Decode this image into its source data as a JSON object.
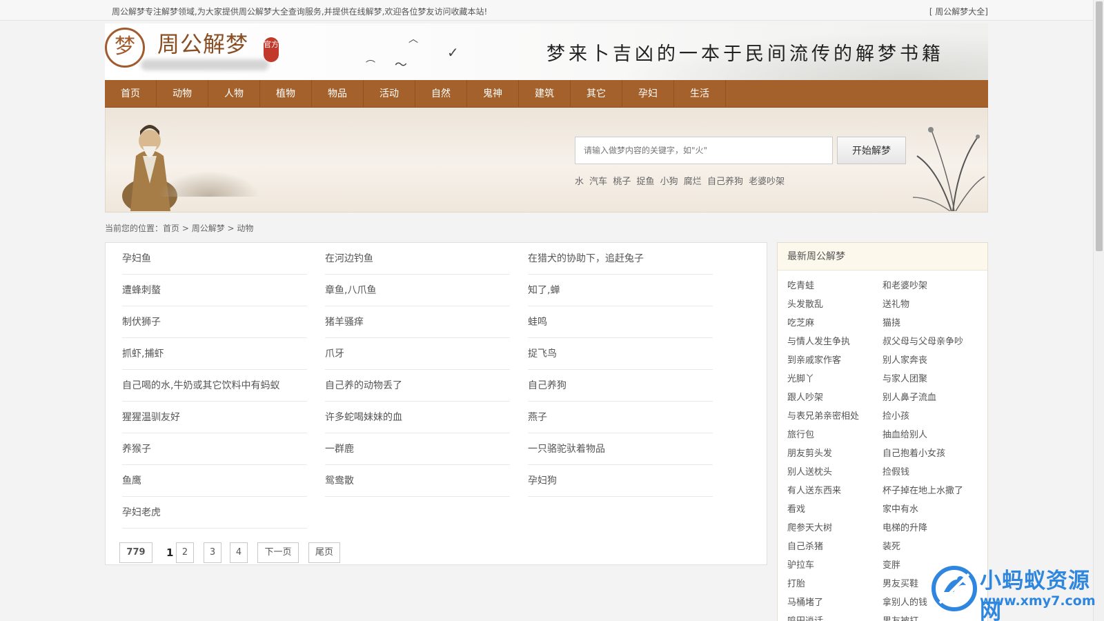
{
  "topbar": {
    "notice": "周公解梦专注解梦领域,为大家提供周公解梦大全查询服务,并提供在线解梦,欢迎各位梦友访问收藏本站!",
    "favorite": "[ 周公解梦大全]"
  },
  "header": {
    "logo_seal": "梦",
    "logo_text": "周公解梦",
    "logo_stamp": "官方",
    "slogan": "梦来卜吉凶的一本于民间流传的解梦书籍"
  },
  "nav": [
    "首页",
    "动物",
    "人物",
    "植物",
    "物品",
    "活动",
    "自然",
    "鬼神",
    "建筑",
    "其它",
    "孕妇",
    "生活"
  ],
  "search": {
    "placeholder": "请输入做梦内容的关键字，如\"火\"",
    "button": "开始解梦",
    "hot_words": [
      "水",
      "汽车",
      "桃子",
      "捉鱼",
      "小狗",
      "腐烂",
      "自己养狗",
      "老婆吵架"
    ]
  },
  "breadcrumb": {
    "prefix": "当前您的位置：",
    "items": [
      "首页",
      "周公解梦",
      "动物"
    ],
    "sep": " > "
  },
  "dream_list": [
    [
      "孕妇鱼",
      "在河边钓鱼",
      "在猎犬的协助下，追赶兔子"
    ],
    [
      "遭蜂刺螯",
      "章鱼,八爪鱼",
      "知了,蝉"
    ],
    [
      "制伏狮子",
      "猪羊骚痒",
      "蛙鸣"
    ],
    [
      "抓虾,捕虾",
      "爪牙",
      "捉飞鸟"
    ],
    [
      "自己喝的水,牛奶或其它饮料中有蚂蚁",
      "自己养的动物丢了",
      "自己养狗"
    ],
    [
      "猩猩温驯友好",
      "许多蛇喝妹妹的血",
      "燕子"
    ],
    [
      "养猴子",
      "一群鹿",
      "一只骆驼驮着物品"
    ],
    [
      "鱼鹰",
      "鸳鸯散",
      "孕妇狗"
    ],
    [
      "孕妇老虎"
    ]
  ],
  "pagination": {
    "total": "779",
    "current": "1",
    "pages": [
      "2",
      "3",
      "4"
    ],
    "next": "下一页",
    "last": "尾页"
  },
  "sidebar": {
    "title": "最新周公解梦",
    "links": [
      [
        "吃青蛙",
        "和老婆吵架"
      ],
      [
        "头发散乱",
        "送礼物"
      ],
      [
        "吃芝麻",
        "猫挠"
      ],
      [
        "与情人发生争执",
        "叔父母与父母亲争吵"
      ],
      [
        "到亲戚家作客",
        "别人家奔丧"
      ],
      [
        "光脚丫",
        "与家人团聚"
      ],
      [
        "跟人吵架",
        "别人鼻子流血"
      ],
      [
        "与表兄弟亲密相处",
        "捡小孩"
      ],
      [
        "旅行包",
        "抽血给别人"
      ],
      [
        "朋友剪头发",
        "自己抱着小女孩"
      ],
      [
        "别人送枕头",
        "捡假钱"
      ],
      [
        "有人送东西来",
        "杯子掉在地上水撒了"
      ],
      [
        "看戏",
        "家中有水"
      ],
      [
        "爬参天大树",
        "电梯的升降"
      ],
      [
        "自己杀猪",
        "装死"
      ],
      [
        "驴拉车",
        "变胖"
      ],
      [
        "打胎",
        "男友买鞋"
      ],
      [
        "马桶堵了",
        "拿别人的钱"
      ],
      [
        "鸣田逍话",
        "男友被打"
      ]
    ]
  },
  "watermark": {
    "name": "小蚂蚁资源网",
    "url": "www.xmy7.com"
  },
  "colors": {
    "nav_bg": "#a4612b",
    "brand_brown": "#8a4e23",
    "watermark_blue": "#2e86de"
  }
}
